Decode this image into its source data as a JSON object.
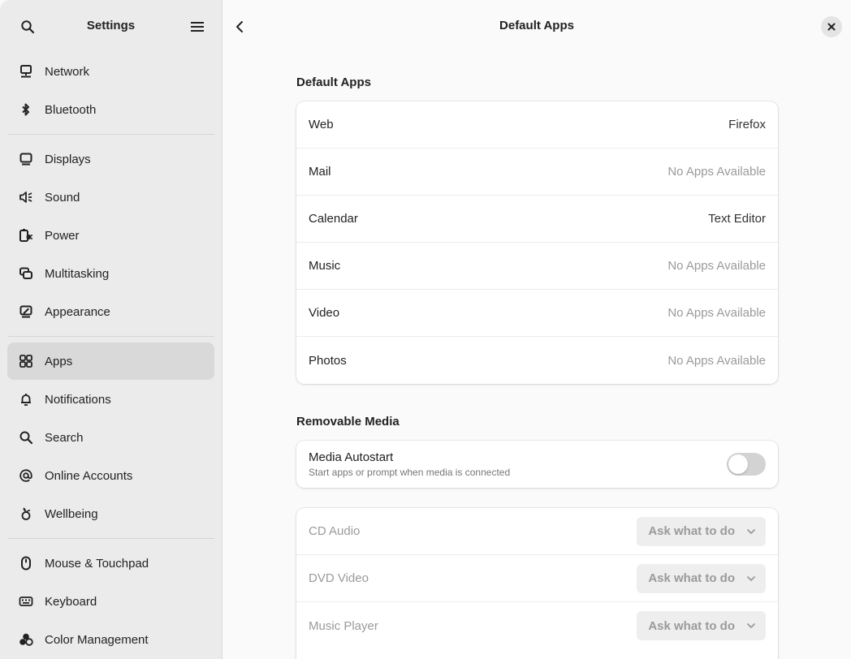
{
  "sidebar": {
    "title": "Settings",
    "search_icon": "search-icon",
    "menu_icon": "hamburger-menu-icon",
    "groups": [
      [
        {
          "label": "Network",
          "icon": "network-icon"
        },
        {
          "label": "Bluetooth",
          "icon": "bluetooth-icon"
        }
      ],
      [
        {
          "label": "Displays",
          "icon": "display-icon"
        },
        {
          "label": "Sound",
          "icon": "speaker-icon"
        },
        {
          "label": "Power",
          "icon": "power-icon"
        },
        {
          "label": "Multitasking",
          "icon": "multitasking-icon"
        },
        {
          "label": "Appearance",
          "icon": "appearance-icon"
        }
      ],
      [
        {
          "label": "Apps",
          "icon": "apps-grid-icon",
          "active": true
        },
        {
          "label": "Notifications",
          "icon": "bell-icon"
        },
        {
          "label": "Search",
          "icon": "search-icon"
        },
        {
          "label": "Online Accounts",
          "icon": "at-sign-icon"
        },
        {
          "label": "Wellbeing",
          "icon": "wellbeing-icon"
        }
      ],
      [
        {
          "label": "Mouse & Touchpad",
          "icon": "mouse-icon"
        },
        {
          "label": "Keyboard",
          "icon": "keyboard-icon"
        },
        {
          "label": "Color Management",
          "icon": "color-management-icon"
        }
      ]
    ]
  },
  "header": {
    "title": "Default Apps",
    "back_icon": "chevron-left-icon",
    "close_icon": "close-icon"
  },
  "default_apps": {
    "title": "Default Apps",
    "rows": [
      {
        "label": "Web",
        "value": "Firefox",
        "dim": false
      },
      {
        "label": "Mail",
        "value": "No Apps Available",
        "dim": true
      },
      {
        "label": "Calendar",
        "value": "Text Editor",
        "dim": false
      },
      {
        "label": "Music",
        "value": "No Apps Available",
        "dim": true
      },
      {
        "label": "Video",
        "value": "No Apps Available",
        "dim": true
      },
      {
        "label": "Photos",
        "value": "No Apps Available",
        "dim": true
      }
    ]
  },
  "removable_media": {
    "title": "Removable Media",
    "autostart": {
      "label": "Media Autostart",
      "subtitle": "Start apps or prompt when media is connected",
      "enabled": false
    },
    "rows": [
      {
        "label": "CD Audio",
        "value": "Ask what to do"
      },
      {
        "label": "DVD Video",
        "value": "Ask what to do"
      },
      {
        "label": "Music Player",
        "value": "Ask what to do"
      }
    ]
  }
}
